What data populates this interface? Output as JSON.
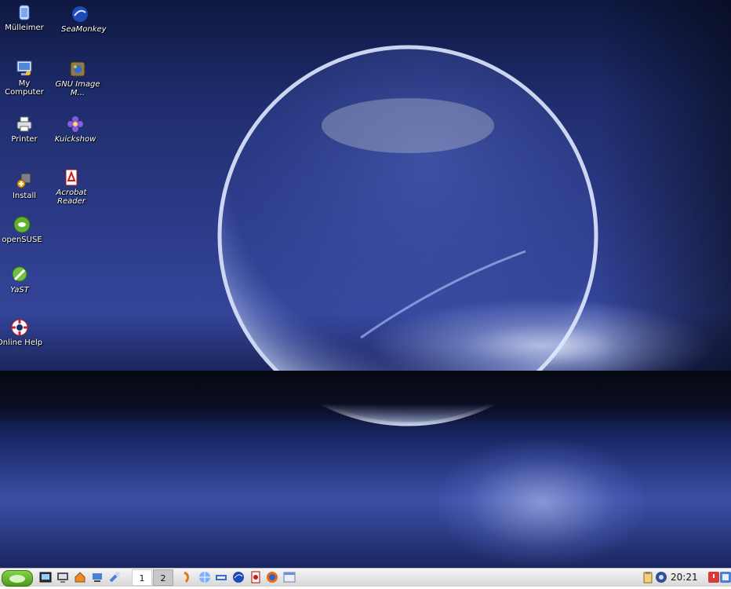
{
  "desktop": {
    "icons": [
      {
        "label": "Mülleimer"
      },
      {
        "label": "SeaMonkey"
      },
      {
        "label": "My Computer"
      },
      {
        "label": "GNU Image M..."
      },
      {
        "label": "Printer"
      },
      {
        "label": "Kuickshow"
      },
      {
        "label": "Install"
      },
      {
        "label": "Acrobat Reader"
      },
      {
        "label": "openSUSE"
      },
      {
        "label": "YaST"
      },
      {
        "label": "Online Help"
      }
    ],
    "colors": {
      "accent": "#2b3a86",
      "sky_dark": "#0e1840",
      "glow": "#ebf0ff"
    }
  },
  "taskbar": {
    "pager": [
      "1",
      "2"
    ],
    "clock": "20:21",
    "quicklaunch": [
      "terminal-icon",
      "home-icon",
      "network-icon",
      "settings-icon"
    ],
    "apps": [
      "java-icon",
      "browser-icon",
      "network-tool-icon",
      "seamonkey-icon",
      "acrobat-icon",
      "firefox-icon",
      "window-icon"
    ],
    "tray": [
      "clipboard-icon",
      "network-status-icon",
      "power-icon",
      "desktop-icon"
    ]
  }
}
